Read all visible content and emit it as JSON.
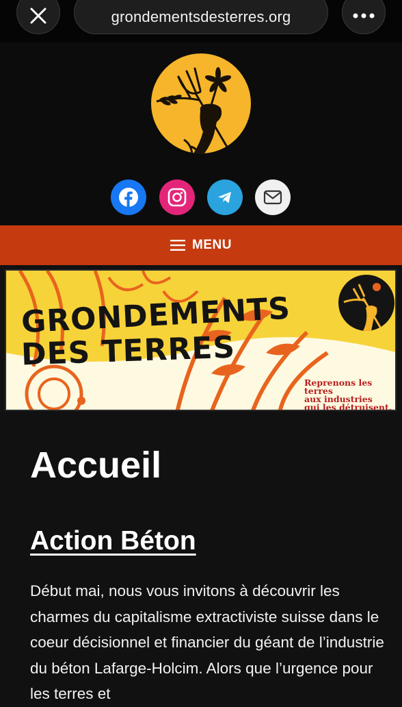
{
  "browser": {
    "url": "grondementsdesterres.org"
  },
  "header": {
    "social_icons": [
      "facebook-icon",
      "instagram-icon",
      "telegram-icon",
      "mail-icon"
    ]
  },
  "menu": {
    "label": "MENU"
  },
  "banner": {
    "title_line1": "GRONDEMENTS",
    "title_line2": "DES TERRES",
    "tagline_line1": "Reprenons les terres",
    "tagline_line2": "aux industries",
    "tagline_line3": "qui les détruisent."
  },
  "main": {
    "page_title": "Accueil",
    "post_title": "Action Béton",
    "post_excerpt": "Début mai, nous vous invitons à découvrir les charmes du capitalisme extractiviste suisse dans le coeur décisionnel et financier du géant de l’industrie du béton Lafarge-Holcim. Alors que l’urgence pour les terres et"
  },
  "colors": {
    "menu_bar": "#c63a0f",
    "logo_yellow": "#f6b52a",
    "facebook": "#1877f2",
    "instagram": "#e4267a",
    "telegram": "#2aa3df",
    "mail": "#f0f0f0"
  }
}
